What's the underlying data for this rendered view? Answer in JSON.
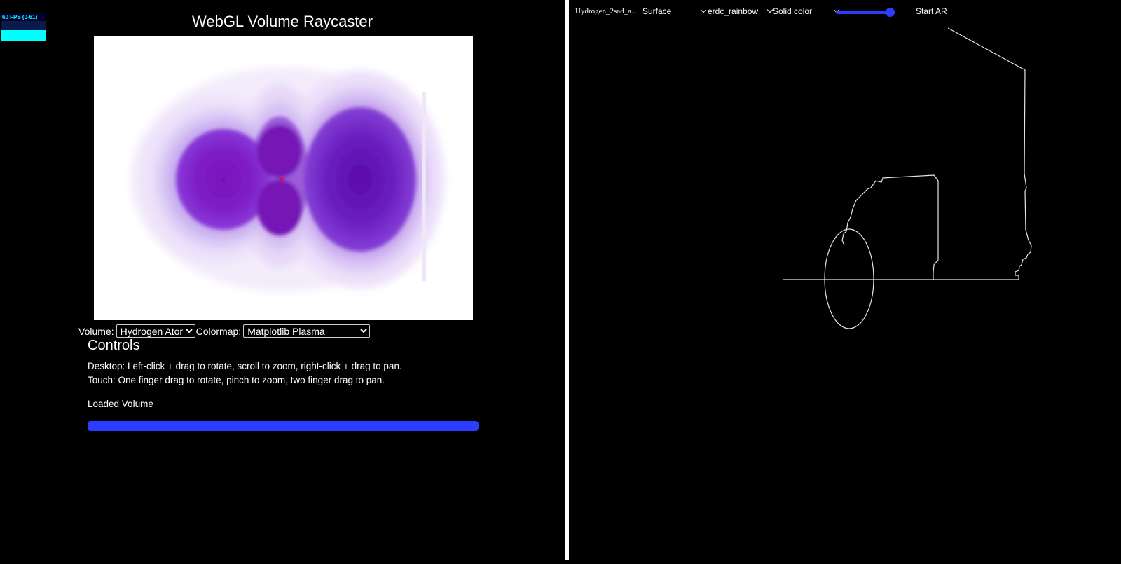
{
  "fps_meter": {
    "label": "60 FPS (0-61)",
    "level": 0.55,
    "color": "#00ffff"
  },
  "app": {
    "title": "WebGL Volume Raycaster"
  },
  "selectors": {
    "volume_label": "Volume:",
    "volume_value": "Hydrogen Atom",
    "colormap_label": "Colormap:",
    "colormap_value": "Matplotlib Plasma"
  },
  "controls": {
    "heading": "Controls",
    "desktop_text": "Desktop: Left-click + drag to rotate, scroll to zoom, right-click + drag to pan.",
    "touch_text": "Touch: One finger drag to rotate, pinch to zoom, two finger drag to pan.",
    "status_text": "Loaded Volume",
    "progress": 1.0,
    "progress_color": "#2b3dff"
  },
  "toolbar": {
    "filename": "Hydrogen_2sad_a...",
    "representation": "Surface",
    "colormap": "erdc_rainbow",
    "color_mode": "Solid color",
    "opacity": 0.9,
    "ar_button": "Start AR",
    "accent_color": "#2b3dff"
  },
  "icons": {
    "dropdown": "chevron-down-icon"
  }
}
